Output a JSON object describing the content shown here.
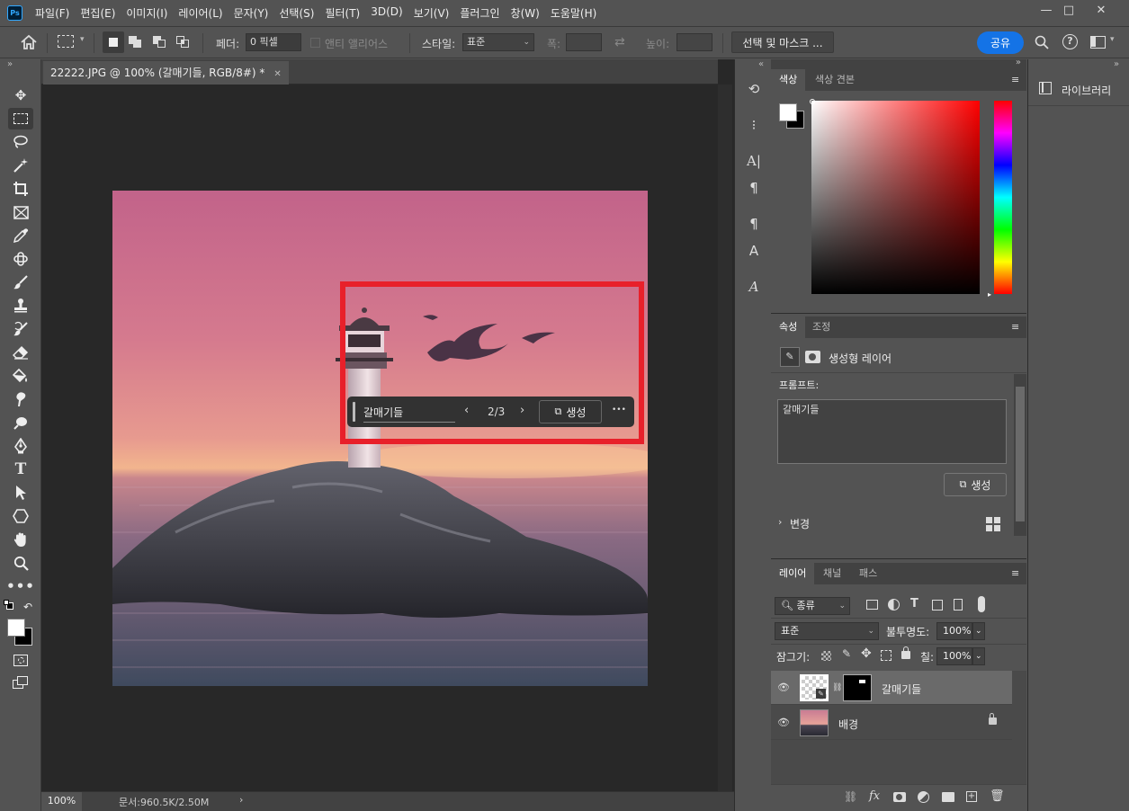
{
  "app": {
    "logo": "Ps"
  },
  "menu": [
    "파일(F)",
    "편집(E)",
    "이미지(I)",
    "레이어(L)",
    "문자(Y)",
    "선택(S)",
    "필터(T)",
    "3D(D)",
    "보기(V)",
    "플러그인",
    "창(W)",
    "도움말(H)"
  ],
  "window_controls": {
    "minimize": "—",
    "maximize": "□",
    "close": "✕"
  },
  "options": {
    "feather_label": "페더:",
    "feather_value": "0 픽셀",
    "antialias_label": "앤티 앨리어스",
    "style_label": "스타일:",
    "style_value": "표준",
    "width_label": "폭:",
    "height_label": "높이:",
    "select_mask_label": "선택 및 마스크 ...",
    "share_label": "공유"
  },
  "document": {
    "tab_title": "22222.JPG @ 100% (갈매기들, RGB/8#) *",
    "zoom": "100%",
    "doc_info": "문서:960.5K/2.50M"
  },
  "generative_bar": {
    "prompt": "갈매기들",
    "counter": "2/3",
    "generate_label": "생성",
    "more": "•••"
  },
  "color_panel": {
    "tabs": [
      "색상",
      "색상 견본"
    ]
  },
  "properties_panel": {
    "tabs": [
      "속성",
      "조정"
    ],
    "layer_type": "생성형 레이어",
    "prompt_label": "프롬프트:",
    "prompt_value": "갈매기들",
    "generate_label": "생성",
    "variations_label": "변경"
  },
  "layers_panel": {
    "tabs": [
      "레이어",
      "채널",
      "패스"
    ],
    "filter_label": "종류",
    "blend_mode": "표준",
    "opacity_label": "불투명도:",
    "opacity_value": "100%",
    "lock_label": "잠그기:",
    "fill_label": "칠:",
    "fill_value": "100%",
    "layers": [
      {
        "name": "갈매기들",
        "selected": true
      },
      {
        "name": "배경",
        "selected": false
      }
    ]
  },
  "libraries_panel": {
    "label": "라이브러리"
  },
  "colors": {
    "accent": "#1473e6",
    "selection_frame": "#e8202a",
    "panel_bg": "#535353"
  }
}
